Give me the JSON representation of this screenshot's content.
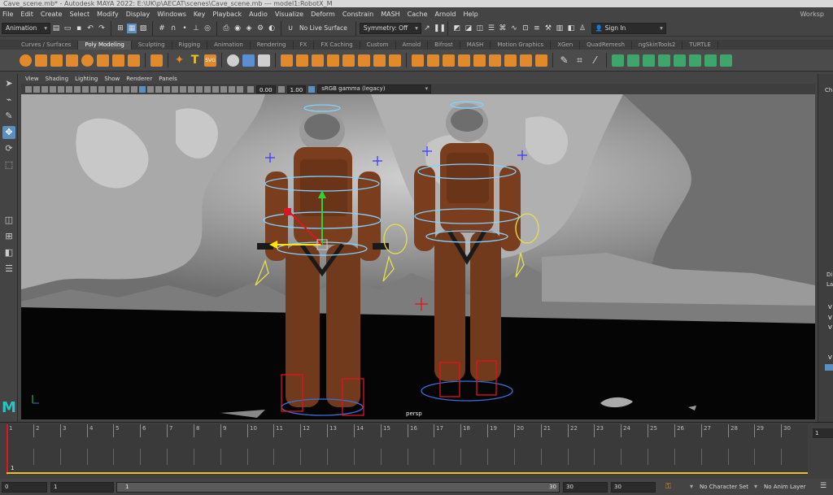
{
  "window": {
    "title": "Cave_scene.mb* - Autodesk MAYA 2022: E:\\UK\\p\\AECAT\\scenes\\Cave_scene.mb  ---  model1:RobotX_M"
  },
  "menubar": {
    "items": [
      "File",
      "Edit",
      "Create",
      "Select",
      "Modify",
      "Display",
      "Windows",
      "Key",
      "Playback",
      "Audio",
      "Visualize",
      "Deform",
      "Constrain",
      "MASH",
      "Cache",
      "Arnold",
      "Help"
    ],
    "workspace_label": "Worksp"
  },
  "statusline": {
    "mode": "Animation",
    "live_surface": "No Live Surface",
    "symmetry": "Symmetry: Off",
    "sign_in": "Sign In"
  },
  "shelf_tabs": [
    "Curves / Surfaces",
    "Poly Modeling",
    "Sculpting",
    "Rigging",
    "Animation",
    "Rendering",
    "FX",
    "FX Caching",
    "Custom",
    "Arnold",
    "Bifrost",
    "MASH",
    "Motion Graphics",
    "XGen",
    "QuadRemesh",
    "ngSkinTools2",
    "TURTLE"
  ],
  "shelf_active_tab": "Poly Modeling",
  "viewport": {
    "menu": [
      "View",
      "Shading",
      "Lighting",
      "Show",
      "Renderer",
      "Panels"
    ],
    "exposure": "0.00",
    "gamma": "1.00",
    "color_space": "sRGB gamma (legacy)",
    "camera_label": "persp"
  },
  "right_panel": {
    "label_top": "Cha",
    "label_mid": "Di",
    "label_lay": "Lay",
    "rows": [
      "V",
      "V",
      "V",
      "V"
    ]
  },
  "timeline": {
    "ticks": [
      "1",
      "2",
      "3",
      "4",
      "5",
      "6",
      "7",
      "8",
      "9",
      "10",
      "11",
      "12",
      "13",
      "14",
      "15",
      "16",
      "17",
      "18",
      "19",
      "20",
      "21",
      "22",
      "23",
      "24",
      "25",
      "26",
      "27",
      "28",
      "29",
      "30"
    ],
    "current_frame_marker": "1",
    "current_frame_field": "1"
  },
  "range": {
    "start": "0",
    "playback_start": "1",
    "slider_start": "1",
    "slider_end": "30",
    "playback_end": "30",
    "anim_end": "30",
    "character_set": "No Character Set",
    "anim_layer": "No Anim Layer"
  },
  "colors": {
    "ui_bg": "#444444",
    "accent_blue": "#5b8fbf",
    "suit_orange": "#8a4a26",
    "control_yellow": "#e6e04a",
    "control_cyan": "#7fd3ff",
    "ik_red": "#e0141e",
    "maya_logo": "#2bc4c4"
  }
}
